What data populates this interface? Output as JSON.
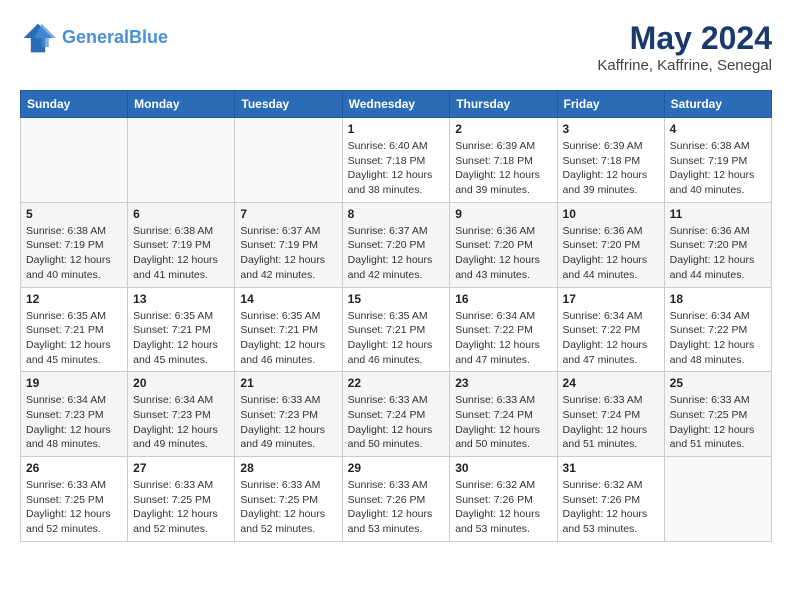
{
  "header": {
    "logo_line1": "General",
    "logo_line2": "Blue",
    "month_year": "May 2024",
    "location": "Kaffrine, Kaffrine, Senegal"
  },
  "weekdays": [
    "Sunday",
    "Monday",
    "Tuesday",
    "Wednesday",
    "Thursday",
    "Friday",
    "Saturday"
  ],
  "weeks": [
    [
      {
        "day": "",
        "info": ""
      },
      {
        "day": "",
        "info": ""
      },
      {
        "day": "",
        "info": ""
      },
      {
        "day": "1",
        "info": "Sunrise: 6:40 AM\nSunset: 7:18 PM\nDaylight: 12 hours\nand 38 minutes."
      },
      {
        "day": "2",
        "info": "Sunrise: 6:39 AM\nSunset: 7:18 PM\nDaylight: 12 hours\nand 39 minutes."
      },
      {
        "day": "3",
        "info": "Sunrise: 6:39 AM\nSunset: 7:18 PM\nDaylight: 12 hours\nand 39 minutes."
      },
      {
        "day": "4",
        "info": "Sunrise: 6:38 AM\nSunset: 7:19 PM\nDaylight: 12 hours\nand 40 minutes."
      }
    ],
    [
      {
        "day": "5",
        "info": "Sunrise: 6:38 AM\nSunset: 7:19 PM\nDaylight: 12 hours\nand 40 minutes."
      },
      {
        "day": "6",
        "info": "Sunrise: 6:38 AM\nSunset: 7:19 PM\nDaylight: 12 hours\nand 41 minutes."
      },
      {
        "day": "7",
        "info": "Sunrise: 6:37 AM\nSunset: 7:19 PM\nDaylight: 12 hours\nand 42 minutes."
      },
      {
        "day": "8",
        "info": "Sunrise: 6:37 AM\nSunset: 7:20 PM\nDaylight: 12 hours\nand 42 minutes."
      },
      {
        "day": "9",
        "info": "Sunrise: 6:36 AM\nSunset: 7:20 PM\nDaylight: 12 hours\nand 43 minutes."
      },
      {
        "day": "10",
        "info": "Sunrise: 6:36 AM\nSunset: 7:20 PM\nDaylight: 12 hours\nand 44 minutes."
      },
      {
        "day": "11",
        "info": "Sunrise: 6:36 AM\nSunset: 7:20 PM\nDaylight: 12 hours\nand 44 minutes."
      }
    ],
    [
      {
        "day": "12",
        "info": "Sunrise: 6:35 AM\nSunset: 7:21 PM\nDaylight: 12 hours\nand 45 minutes."
      },
      {
        "day": "13",
        "info": "Sunrise: 6:35 AM\nSunset: 7:21 PM\nDaylight: 12 hours\nand 45 minutes."
      },
      {
        "day": "14",
        "info": "Sunrise: 6:35 AM\nSunset: 7:21 PM\nDaylight: 12 hours\nand 46 minutes."
      },
      {
        "day": "15",
        "info": "Sunrise: 6:35 AM\nSunset: 7:21 PM\nDaylight: 12 hours\nand 46 minutes."
      },
      {
        "day": "16",
        "info": "Sunrise: 6:34 AM\nSunset: 7:22 PM\nDaylight: 12 hours\nand 47 minutes."
      },
      {
        "day": "17",
        "info": "Sunrise: 6:34 AM\nSunset: 7:22 PM\nDaylight: 12 hours\nand 47 minutes."
      },
      {
        "day": "18",
        "info": "Sunrise: 6:34 AM\nSunset: 7:22 PM\nDaylight: 12 hours\nand 48 minutes."
      }
    ],
    [
      {
        "day": "19",
        "info": "Sunrise: 6:34 AM\nSunset: 7:23 PM\nDaylight: 12 hours\nand 48 minutes."
      },
      {
        "day": "20",
        "info": "Sunrise: 6:34 AM\nSunset: 7:23 PM\nDaylight: 12 hours\nand 49 minutes."
      },
      {
        "day": "21",
        "info": "Sunrise: 6:33 AM\nSunset: 7:23 PM\nDaylight: 12 hours\nand 49 minutes."
      },
      {
        "day": "22",
        "info": "Sunrise: 6:33 AM\nSunset: 7:24 PM\nDaylight: 12 hours\nand 50 minutes."
      },
      {
        "day": "23",
        "info": "Sunrise: 6:33 AM\nSunset: 7:24 PM\nDaylight: 12 hours\nand 50 minutes."
      },
      {
        "day": "24",
        "info": "Sunrise: 6:33 AM\nSunset: 7:24 PM\nDaylight: 12 hours\nand 51 minutes."
      },
      {
        "day": "25",
        "info": "Sunrise: 6:33 AM\nSunset: 7:25 PM\nDaylight: 12 hours\nand 51 minutes."
      }
    ],
    [
      {
        "day": "26",
        "info": "Sunrise: 6:33 AM\nSunset: 7:25 PM\nDaylight: 12 hours\nand 52 minutes."
      },
      {
        "day": "27",
        "info": "Sunrise: 6:33 AM\nSunset: 7:25 PM\nDaylight: 12 hours\nand 52 minutes."
      },
      {
        "day": "28",
        "info": "Sunrise: 6:33 AM\nSunset: 7:25 PM\nDaylight: 12 hours\nand 52 minutes."
      },
      {
        "day": "29",
        "info": "Sunrise: 6:33 AM\nSunset: 7:26 PM\nDaylight: 12 hours\nand 53 minutes."
      },
      {
        "day": "30",
        "info": "Sunrise: 6:32 AM\nSunset: 7:26 PM\nDaylight: 12 hours\nand 53 minutes."
      },
      {
        "day": "31",
        "info": "Sunrise: 6:32 AM\nSunset: 7:26 PM\nDaylight: 12 hours\nand 53 minutes."
      },
      {
        "day": "",
        "info": ""
      }
    ]
  ]
}
